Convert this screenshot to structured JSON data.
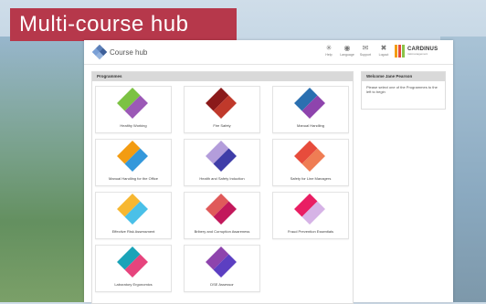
{
  "banner": {
    "title": "Multi-course hub"
  },
  "header": {
    "app_title": "Course hub",
    "nav": [
      {
        "label": "Help",
        "icon": "help-icon",
        "glyph": "✳"
      },
      {
        "label": "Language",
        "icon": "globe-icon",
        "glyph": "◉"
      },
      {
        "label": "Support",
        "icon": "chat-icon",
        "glyph": "✉"
      },
      {
        "label": "Logout",
        "icon": "close-icon",
        "glyph": "✖"
      }
    ],
    "brand": {
      "name": "CARDINUS",
      "tagline": "riskmanagement"
    }
  },
  "programmes": {
    "heading": "Programmes",
    "courses": [
      {
        "label": "Healthy Working",
        "colors": [
          "#7cc243",
          "#9b59b6"
        ]
      },
      {
        "label": "Fire Safety",
        "colors": [
          "#8b1a1a",
          "#c0392b"
        ]
      },
      {
        "label": "Manual Handling",
        "colors": [
          "#2a6fb0",
          "#8e44ad"
        ]
      },
      {
        "label": "Manual Handling for the Office",
        "colors": [
          "#f39c12",
          "#3498db"
        ]
      },
      {
        "label": "Health and Safety Induction",
        "colors": [
          "#b39ddb",
          "#3f3da8"
        ]
      },
      {
        "label": "Safety for Line Managers",
        "colors": [
          "#e74c3c",
          "#ef7d54"
        ]
      },
      {
        "label": "Effective Risk Assessment",
        "colors": [
          "#f7b731",
          "#4ac0e8"
        ]
      },
      {
        "label": "Bribery and Corruption Awareness",
        "colors": [
          "#e05a5a",
          "#c2185b"
        ]
      },
      {
        "label": "Fraud Prevention Essentials",
        "colors": [
          "#e91e63",
          "#d6b3e6"
        ]
      },
      {
        "label": "Laboratory Ergonomics",
        "colors": [
          "#1aa3b8",
          "#e6447d"
        ]
      },
      {
        "label": "DSE Assessor",
        "colors": [
          "#8e44ad",
          "#5c3fc2"
        ]
      }
    ]
  },
  "welcome": {
    "heading": "Welcome Jane Pearson",
    "message": "Please select one of the Programmes to the left to begin"
  }
}
